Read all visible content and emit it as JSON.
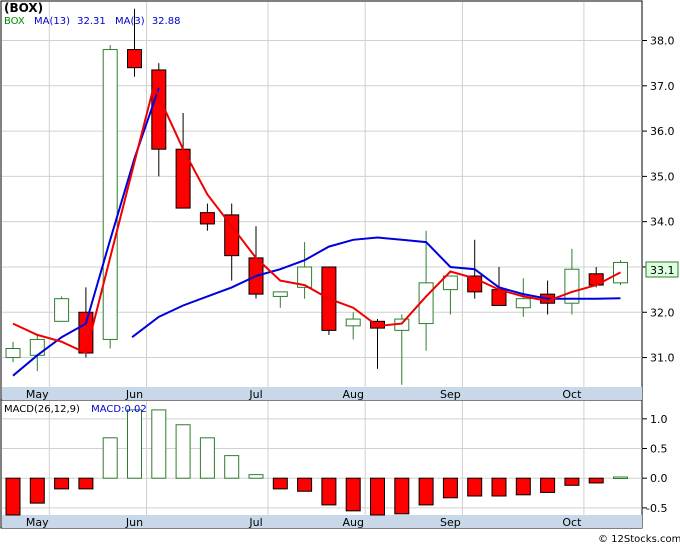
{
  "header": {
    "title": "(BOX)",
    "legend_symbol": "BOX",
    "ma13_label": "MA(13)",
    "ma13_value": "32.31",
    "ma3_label": "MA(3)",
    "ma3_value": "32.88",
    "macd_label": "MACD(26,12,9)",
    "macd_value_label": "MACD:0.02",
    "last_price_tag": "33.1",
    "footer": "© 12Stocks.com"
  },
  "colors": {
    "up_candle": "#2e7d2e",
    "down_candle": "#ff0000",
    "ma13_line": "#0000dd",
    "ma3_line": "#ee0000",
    "macd_up": "#2e7d2e",
    "macd_down": "#ff0000",
    "price_tag_bg": "#ddffdd",
    "price_tag_border": "#2e7d2e",
    "axis_strip": "#c8d8e8",
    "legend_green": "#008800",
    "legend_blue": "#0000cc"
  },
  "chart_data": [
    {
      "type": "candlestick",
      "name": "price",
      "ylim": [
        30.35,
        38.85
      ],
      "y_ticks": [
        31.0,
        32.0,
        33.0,
        34.0,
        35.0,
        36.0,
        37.0,
        38.0
      ],
      "y_tick_labels": [
        "31.0",
        "32.0",
        "33.0",
        "34.0",
        "35.0",
        "36.0",
        "37.0",
        "38.0"
      ],
      "months": [
        "May",
        "Jun",
        "Jul",
        "Aug",
        "Sep",
        "Oct"
      ],
      "candles": [
        {
          "o": 31.0,
          "h": 31.35,
          "l": 30.9,
          "c": 31.2
        },
        {
          "o": 31.05,
          "h": 31.5,
          "l": 30.7,
          "c": 31.4
        },
        {
          "o": 31.8,
          "h": 32.35,
          "l": 31.8,
          "c": 32.3
        },
        {
          "o": 32.0,
          "h": 32.55,
          "l": 31.0,
          "c": 31.1
        },
        {
          "o": 31.4,
          "h": 37.9,
          "l": 31.2,
          "c": 37.8
        },
        {
          "o": 37.8,
          "h": 38.7,
          "l": 37.2,
          "c": 37.4
        },
        {
          "o": 37.35,
          "h": 37.5,
          "l": 35.0,
          "c": 35.6
        },
        {
          "o": 35.6,
          "h": 36.4,
          "l": 34.3,
          "c": 34.3
        },
        {
          "o": 34.2,
          "h": 34.4,
          "l": 33.8,
          "c": 33.95
        },
        {
          "o": 34.15,
          "h": 34.4,
          "l": 32.7,
          "c": 33.25
        },
        {
          "o": 33.2,
          "h": 33.9,
          "l": 32.3,
          "c": 32.4
        },
        {
          "o": 32.35,
          "h": 32.45,
          "l": 32.1,
          "c": 32.45
        },
        {
          "o": 32.55,
          "h": 33.55,
          "l": 32.3,
          "c": 33.0
        },
        {
          "o": 33.0,
          "h": 33.0,
          "l": 31.5,
          "c": 31.6
        },
        {
          "o": 31.7,
          "h": 32.0,
          "l": 31.4,
          "c": 31.85
        },
        {
          "o": 31.8,
          "h": 31.85,
          "l": 30.75,
          "c": 31.65
        },
        {
          "o": 31.6,
          "h": 31.95,
          "l": 30.4,
          "c": 31.85
        },
        {
          "o": 31.75,
          "h": 33.8,
          "l": 31.15,
          "c": 32.65
        },
        {
          "o": 32.5,
          "h": 32.8,
          "l": 31.95,
          "c": 32.8
        },
        {
          "o": 32.8,
          "h": 33.6,
          "l": 32.3,
          "c": 32.45
        },
        {
          "o": 32.5,
          "h": 33.0,
          "l": 32.15,
          "c": 32.15
        },
        {
          "o": 32.1,
          "h": 32.75,
          "l": 31.9,
          "c": 32.3
        },
        {
          "o": 32.4,
          "h": 32.7,
          "l": 31.95,
          "c": 32.2
        },
        {
          "o": 32.2,
          "h": 33.4,
          "l": 31.95,
          "c": 32.95
        },
        {
          "o": 32.85,
          "h": 33.0,
          "l": 32.55,
          "c": 32.6
        },
        {
          "o": 32.65,
          "h": 33.15,
          "l": 32.6,
          "c": 33.1
        }
      ],
      "ma13": [
        30.6,
        31.0,
        31.45,
        31.7,
        33.6,
        36.35,
        null,
        null,
        null,
        null,
        null,
        null,
        null,
        null,
        null,
        null,
        null,
        null,
        null,
        null,
        null,
        null,
        null,
        null,
        null,
        null
      ],
      "ma13_tail": [
        {
          "i": 4.9,
          "v": 31.45
        },
        {
          "i": 6,
          "v": 31.9
        },
        {
          "i": 7,
          "v": 32.15
        },
        {
          "i": 8,
          "v": 32.35
        },
        {
          "i": 9,
          "v": 32.55
        },
        {
          "i": 10,
          "v": 32.8
        },
        {
          "i": 11,
          "v": 32.95
        },
        {
          "i": 12,
          "v": 33.15
        },
        {
          "i": 13,
          "v": 33.45
        },
        {
          "i": 14,
          "v": 33.6
        },
        {
          "i": 15,
          "v": 33.65
        },
        {
          "i": 16,
          "v": 33.6
        },
        {
          "i": 17,
          "v": 33.55
        },
        {
          "i": 18,
          "v": 33.0
        },
        {
          "i": 19,
          "v": 32.95
        },
        {
          "i": 20,
          "v": 32.55
        },
        {
          "i": 21,
          "v": 32.4
        },
        {
          "i": 22,
          "v": 32.3
        },
        {
          "i": 23,
          "v": 32.3
        },
        {
          "i": 24,
          "v": 32.3
        },
        {
          "i": 25,
          "v": 32.31
        }
      ],
      "ma13_head": [
        {
          "i": 0,
          "v": 30.6
        },
        {
          "i": 1,
          "v": 31.05
        },
        {
          "i": 2,
          "v": 31.45
        },
        {
          "i": 3,
          "v": 31.75
        },
        {
          "i": 4,
          "v": 33.6
        },
        {
          "i": 5,
          "v": 35.4
        },
        {
          "i": 6,
          "v": 36.95
        }
      ],
      "ma3": [
        {
          "i": 0,
          "v": 31.75
        },
        {
          "i": 1,
          "v": 31.5
        },
        {
          "i": 2,
          "v": 31.35
        },
        {
          "i": 3,
          "v": 31.1
        },
        {
          "i": 5.8,
          "v": 37.0
        },
        {
          "i": 7,
          "v": 35.6
        },
        {
          "i": 8,
          "v": 34.6
        },
        {
          "i": 9,
          "v": 33.9
        },
        {
          "i": 10,
          "v": 33.2
        },
        {
          "i": 11,
          "v": 32.7
        },
        {
          "i": 12,
          "v": 32.6
        },
        {
          "i": 13,
          "v": 32.3
        },
        {
          "i": 14,
          "v": 32.1
        },
        {
          "i": 15,
          "v": 31.7
        },
        {
          "i": 16,
          "v": 31.75
        },
        {
          "i": 17,
          "v": 32.35
        },
        {
          "i": 18,
          "v": 32.9
        },
        {
          "i": 19,
          "v": 32.75
        },
        {
          "i": 20,
          "v": 32.5
        },
        {
          "i": 21,
          "v": 32.35
        },
        {
          "i": 22,
          "v": 32.25
        },
        {
          "i": 23,
          "v": 32.45
        },
        {
          "i": 24,
          "v": 32.6
        },
        {
          "i": 25,
          "v": 32.88
        }
      ]
    },
    {
      "type": "bar",
      "name": "macd",
      "ylim": [
        -0.62,
        1.3
      ],
      "y_ticks": [
        -0.5,
        0.0,
        0.5,
        1.0
      ],
      "y_tick_labels": [
        "-0.5",
        "0.0",
        "0.5",
        "1.0"
      ],
      "values": [
        -0.62,
        -0.42,
        -0.18,
        -0.18,
        0.68,
        1.15,
        1.15,
        0.9,
        0.68,
        0.38,
        0.06,
        -0.18,
        -0.22,
        -0.45,
        -0.55,
        -0.62,
        -0.6,
        -0.45,
        -0.33,
        -0.3,
        -0.3,
        -0.28,
        -0.24,
        -0.12,
        -0.08,
        0.02
      ]
    }
  ]
}
